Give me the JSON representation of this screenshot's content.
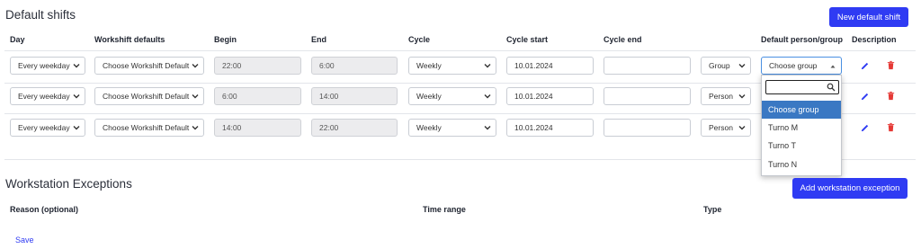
{
  "default_shifts": {
    "title": "Default shifts",
    "new_button": "New default shift",
    "columns": {
      "day": "Day",
      "workshift_defaults": "Workshift defaults",
      "begin": "Begin",
      "end": "End",
      "cycle": "Cycle",
      "cycle_start": "Cycle start",
      "cycle_end": "Cycle end",
      "default_person_group": "Default person/group",
      "description": "Description"
    },
    "rows": [
      {
        "day": "Every weekday",
        "workshift": "Choose Workshift Default",
        "begin": "22:00",
        "end": "6:00",
        "cycle": "Weekly",
        "cycle_start": "10.01.2024",
        "cycle_end": "",
        "type": "Group",
        "person_group": "Choose group"
      },
      {
        "day": "Every weekday",
        "workshift": "Choose Workshift Default",
        "begin": "6:00",
        "end": "14:00",
        "cycle": "Weekly",
        "cycle_start": "10.01.2024",
        "cycle_end": "",
        "type": "Person",
        "person_group": ""
      },
      {
        "day": "Every weekday",
        "workshift": "Choose Workshift Default",
        "begin": "14:00",
        "end": "22:00",
        "cycle": "Weekly",
        "cycle_start": "10.01.2024",
        "cycle_end": "",
        "type": "Person",
        "person_group": ""
      }
    ],
    "dropdown": {
      "search_value": "",
      "options": [
        "Choose group",
        "Turno M",
        "Turno T",
        "Turno N"
      ],
      "selected": "Choose group"
    }
  },
  "workstation_exceptions": {
    "title": "Workstation Exceptions",
    "add_button": "Add workstation exception",
    "columns": {
      "reason": "Reason (optional)",
      "time_range": "Time range",
      "type": "Type"
    },
    "save_label": "Save"
  },
  "colors": {
    "primary": "#2f3bf3",
    "edit_icon": "#2f3bf3",
    "delete_icon": "#e53935",
    "selected_option": "#3a78c3"
  }
}
